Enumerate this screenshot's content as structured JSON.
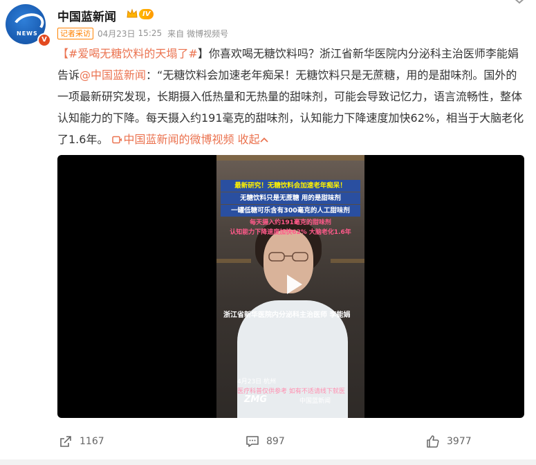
{
  "account": {
    "name": "中国蓝新闻",
    "level": "IV",
    "avatar_text": "NEWS",
    "verified_mark": "V"
  },
  "meta": {
    "tag": "记者采访",
    "date": "04月23日",
    "time": "15:25",
    "source_prefix": "来自",
    "source": "微博视频号"
  },
  "post": {
    "hashtag": "#爱喝无糖饮料的天塌了#",
    "text_1": "你喜欢喝无糖饮料吗？浙江省新华医院内分泌科主治医师李能娟告诉",
    "mention": "@中国蓝新闻",
    "text_2": "：“无糖饮料会加速老年痴呆！无糖饮料只是无蔗糖，用的是甜味剂。国外的一项最新研究发现，长期摄入低热量和无热量的甜味剂，可能会导致记忆力，语言流畅性，整体认知能力的下降。每天摄入约191毫克的甜味剂，认知能力下降速度加快62%，相当于大脑老化了1.6年。",
    "video_link": "中国蓝新闻的微博视频",
    "collapse": "收起"
  },
  "video": {
    "caption_1": "最新研究！无糖饮料会加速老年痴呆！",
    "caption_2": "无糖饮料只是无蔗糖 用的是甜味剂",
    "caption_3": "一罐低糖可乐含有300毫克的人工甜味剂",
    "caption_4": "每天摄入约191毫克的甜味剂",
    "caption_5": "认知能力下降速度加快62% 大脑老化1.6年",
    "speaker": "浙江省新华医院内分泌科主治医师 李能娟",
    "date_place": "4月23日  杭州",
    "disclaimer": "医疗科普仅供参考 如有不适请线下就医",
    "logo_zmg": "ZMG",
    "logo_cbn": "中国蓝新闻"
  },
  "actions": {
    "share_count": "1167",
    "comment_count": "897",
    "like_count": "3977"
  },
  "colors": {
    "link": "#eb7350",
    "reporter_tag": "#ff8200",
    "caption_bg": "#2a4fa0"
  }
}
